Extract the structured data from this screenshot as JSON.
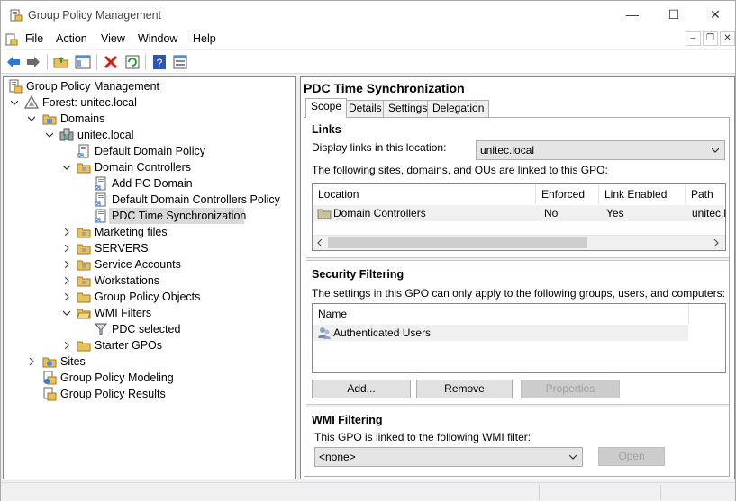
{
  "window": {
    "title": "Group Policy Management",
    "minimize": "—",
    "maximize": "☐",
    "close": "✕"
  },
  "menu": {
    "items": [
      "File",
      "Action",
      "View",
      "Window",
      "Help"
    ],
    "mdi_min": "–",
    "mdi_restore": "❐",
    "mdi_close": "✕"
  },
  "tree": {
    "root": "Group Policy Management",
    "forest": "Forest: unitec.local",
    "domains": "Domains",
    "domain": "unitec.local",
    "default_domain_policy": "Default Domain Policy",
    "domain_controllers": "Domain Controllers",
    "add_pc_domain": "Add PC Domain",
    "default_dc_policy": "Default Domain Controllers Policy",
    "pdc_time_sync": "PDC Time Synchronization",
    "marketing_files": "Marketing files",
    "servers": "SERVERS",
    "service_accounts": "Service Accounts",
    "workstations": "Workstations",
    "gpo": "Group Policy Objects",
    "wmi_filters": "WMI Filters",
    "pdc_selected": "PDC selected",
    "starter_gpos": "Starter GPOs",
    "sites": "Sites",
    "modeling": "Group Policy Modeling",
    "results": "Group Policy Results"
  },
  "details": {
    "title": "PDC Time Synchronization",
    "tabs": [
      "Scope",
      "Details",
      "Settings",
      "Delegation"
    ],
    "links": {
      "heading": "Links",
      "display_label": "Display links in this location:",
      "location_value": "unitec.local",
      "desc": "The following sites, domains, and OUs are linked to this GPO:",
      "columns": [
        "Location",
        "Enforced",
        "Link Enabled",
        "Path"
      ],
      "rows": [
        {
          "location": "Domain Controllers",
          "enforced": "No",
          "link_enabled": "Yes",
          "path": "unitec.l"
        }
      ]
    },
    "security": {
      "heading": "Security Filtering",
      "desc": "The settings in this GPO can only apply to the following groups, users, and computers:",
      "column": "Name",
      "rows": [
        "Authenticated Users"
      ],
      "add": "Add...",
      "remove": "Remove",
      "properties": "Properties"
    },
    "wmi": {
      "heading": "WMI Filtering",
      "desc": "This GPO is linked to the following WMI filter:",
      "value": "<none>",
      "open": "Open"
    }
  },
  "colors": {
    "selection": "#d9d9d9",
    "accent": "#0078d7"
  }
}
